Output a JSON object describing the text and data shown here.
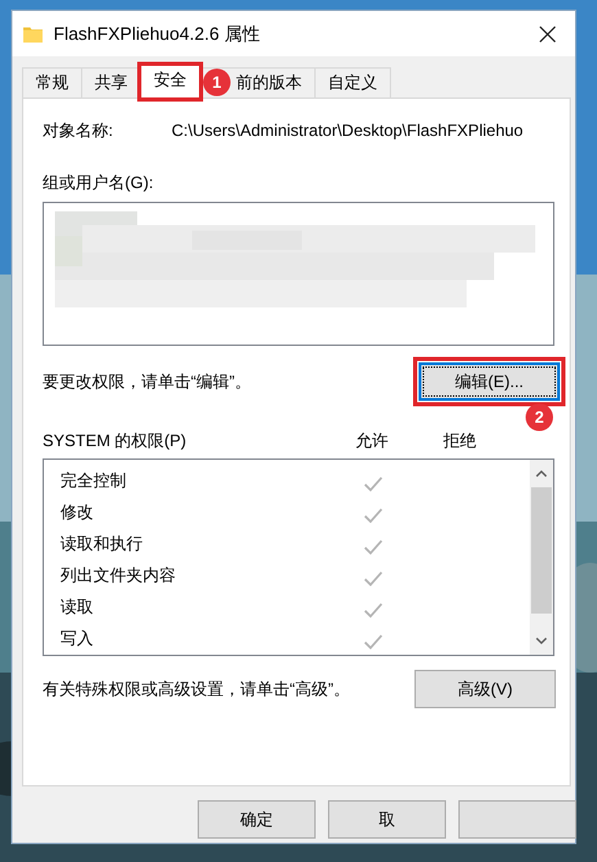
{
  "window": {
    "title": "FlashFXPliehuo4.2.6 属性"
  },
  "tabs": [
    {
      "label": "常规",
      "selected": false,
      "highlighted": false
    },
    {
      "label": "共享",
      "selected": false,
      "highlighted": false
    },
    {
      "label": "安全",
      "selected": true,
      "highlighted": true
    },
    {
      "label": "前的版本",
      "selected": false,
      "highlighted": false
    },
    {
      "label": "自定义",
      "selected": false,
      "highlighted": false
    }
  ],
  "object_name": {
    "label": "对象名称:",
    "value": "C:\\Users\\Administrator\\Desktop\\FlashFXPliehuo"
  },
  "groups": {
    "label": "组或用户名(G):"
  },
  "edit_hint": "要更改权限，请单击“编辑”。",
  "edit_button": {
    "label": "编辑(E)...",
    "focused": true,
    "highlighted": true
  },
  "permissions": {
    "label": "SYSTEM 的权限(P)",
    "allow_header": "允许",
    "deny_header": "拒绝",
    "rows": [
      {
        "name": "完全控制",
        "allow": true,
        "deny": false
      },
      {
        "name": "修改",
        "allow": true,
        "deny": false
      },
      {
        "name": "读取和执行",
        "allow": true,
        "deny": false
      },
      {
        "name": "列出文件夹内容",
        "allow": true,
        "deny": false
      },
      {
        "name": "读取",
        "allow": true,
        "deny": false
      },
      {
        "name": "写入",
        "allow": true,
        "deny": false
      }
    ]
  },
  "advanced_hint": "有关特殊权限或高级设置，请单击“高级”。",
  "advanced_button": "高级(V)",
  "buttons": [
    {
      "label": "确定"
    },
    {
      "label": "取"
    }
  ],
  "annotations": [
    {
      "number": "1"
    },
    {
      "number": "2"
    }
  ]
}
